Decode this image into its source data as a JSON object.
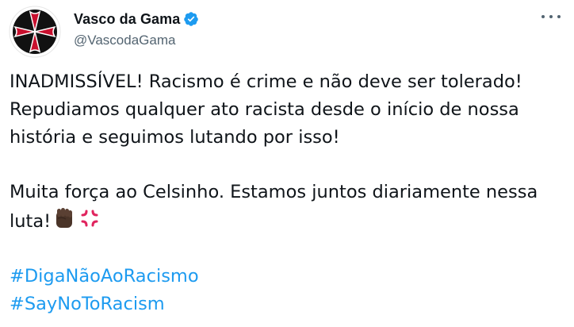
{
  "author": {
    "display_name": "Vasco da Gama",
    "handle": "@VascodaGama",
    "verified": true
  },
  "tweet": {
    "paragraph1": "INADMISSÍVEL! Racismo é crime e não deve ser tolerado! Repudiamos qualquer ato racista desde o início de nossa história e seguimos lutando por isso!",
    "paragraph2": "Muita força ao Celsinho. Estamos juntos diariamente nessa luta!",
    "emojis": [
      "raised-fist-dark-skin-tone",
      "anger-symbol"
    ],
    "hashtags": [
      "#DigaNãoAoRacismo",
      "#SayNoToRacism"
    ]
  },
  "colors": {
    "link": "#1d9bf0",
    "text": "#0f1419",
    "secondary": "#536471",
    "verified": "#1d9bf0",
    "crest_red": "#c8102e"
  },
  "icons": {
    "avatar": "vasco-cross-crest",
    "verified": "verified-badge-icon",
    "more": "more-options-icon"
  }
}
